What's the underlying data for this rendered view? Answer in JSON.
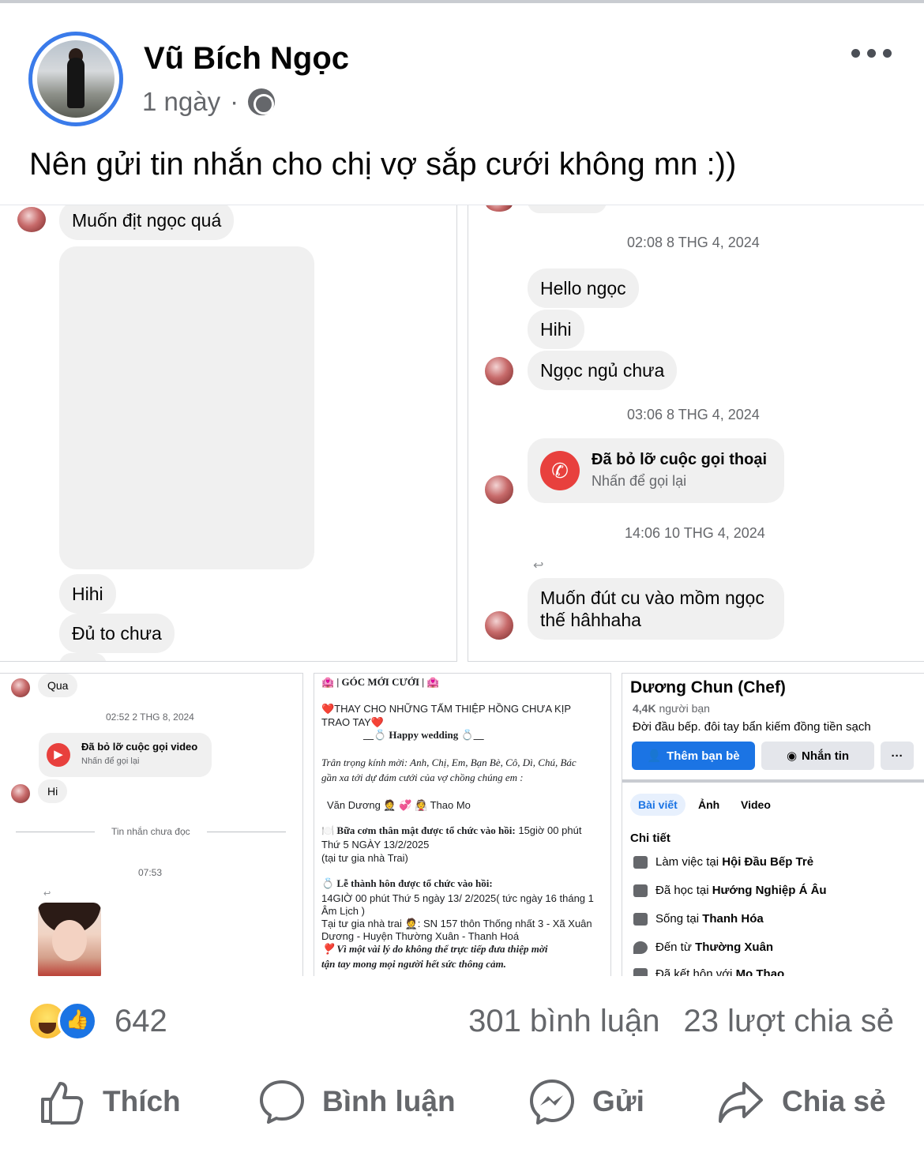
{
  "post": {
    "author": "Vũ Bích Ngọc",
    "time": "1 ngày",
    "separator": "·",
    "caption": "Nên gửi tin nhắn cho chị vợ sắp cưới không mn :))"
  },
  "panel1": {
    "msg_top": "Muốn địt ngọc quá",
    "msg_hihi": "Hihi",
    "msg_du": "Đủ to chưa"
  },
  "panel2": {
    "ts1": "02:08 8 THG 4, 2024",
    "msg_hello": "Hello ngọc",
    "msg_hihi": "Hihi",
    "msg_ngu": "Ngọc ngủ chưa",
    "ts2": "03:06 8 THG 4, 2024",
    "call_title": "Đã bỏ lỡ cuộc gọi thoại",
    "call_sub": "Nhấn để gọi lại",
    "ts3": "14:06 10 THG 4, 2024",
    "msg_last_1": "Muốn đút cu vào mồm ngọc",
    "msg_last_2": "thế hâhhaha"
  },
  "panel3": {
    "msg_qua": "Qua",
    "ts1": "02:52 2 THG 8, 2024",
    "call_title": "Đã bỏ lỡ cuộc gọi video",
    "call_sub": "Nhấn để gọi lại",
    "msg_hi": "Hi",
    "unread": "Tin nhắn chưa đọc",
    "ts2": "07:53"
  },
  "panel4": {
    "header": "🏩 | GÓC MỚI CƯỚI | 🏩",
    "line1": "❤️THAY CHO NHỮNG TẤM THIỆP HỒNG  CHƯA KỊP",
    "line2": "TRAO TAY❤️",
    "line3": "__💍 Happy wedding 💍__",
    "line4": "Trân trọng kính mời: Anh, Chị, Em, Bạn Bè, Cô, Dì, Chú, Bác",
    "line5": "gần xa tới dự đám cưới của vợ chồng chúng em :",
    "line6": "Văn Dương 🤵 💞 👰 Thao Mo",
    "line7_b": "🍽️ Bữa cơm thân mật được tổ chức vào hồi:",
    "line7_r": " 15giờ 00 phút",
    "line8": "Thứ 5 NGÀY 13/2/2025",
    "line9": "(tại tư gia nhà Trai)",
    "line10": "💍 Lễ thành hôn được tổ chức vào hồi:",
    "line11": "14GIỜ 00 phút Thứ 5 ngày 13/ 2/2025( tức ngày 16 tháng 1",
    "line12": "Âm Lịch )",
    "line13": "Tại tư gia nhà trai 🤵: SN 157 thôn Thống nhất 3 - Xã Xuân",
    "line14": "Dương - Huyện Thường Xuân - Thanh Hoá",
    "line15": "❣️ Vì một vài lý do không thể trực tiếp đưa thiệp mời",
    "line16": "tận tay mong mọi người hết sức thông cảm."
  },
  "panel5": {
    "name": "Dương Chun (Chef)",
    "friends_count": "4,4K",
    "friends_label": " người bạn",
    "bio": "Đời đầu bếp. đôi tay bẩn kiếm đồng tiền sạch",
    "add_friend": "Thêm bạn bè",
    "message": "Nhắn tin",
    "more": "···",
    "tabs": [
      "Bài viết",
      "Ảnh",
      "Video"
    ],
    "details_title": "Chi tiết",
    "work_pre": "Làm việc tại ",
    "work": "Hội Đầu Bếp Trẻ",
    "study_pre": "Đã học tại ",
    "study": "Hướng Nghiệp Á Âu",
    "live_pre": "Sống tại ",
    "live": "Thanh Hóa",
    "from_pre": "Đến từ ",
    "from": "Thường Xuân",
    "married_pre": "Đã kết hôn với ",
    "married": "Mo Thao"
  },
  "stats": {
    "reactions": "642",
    "comments": "301 bình luận",
    "shares": "23 lượt chia sẻ"
  },
  "actions": {
    "like": "Thích",
    "comment": "Bình luận",
    "send": "Gửi",
    "share": "Chia sẻ"
  },
  "colors": {
    "brand_blue": "#1b74e4",
    "missed_call_red": "#e8403d",
    "bubble_gray": "#f0f0f0",
    "secondary_text": "#65676b"
  }
}
